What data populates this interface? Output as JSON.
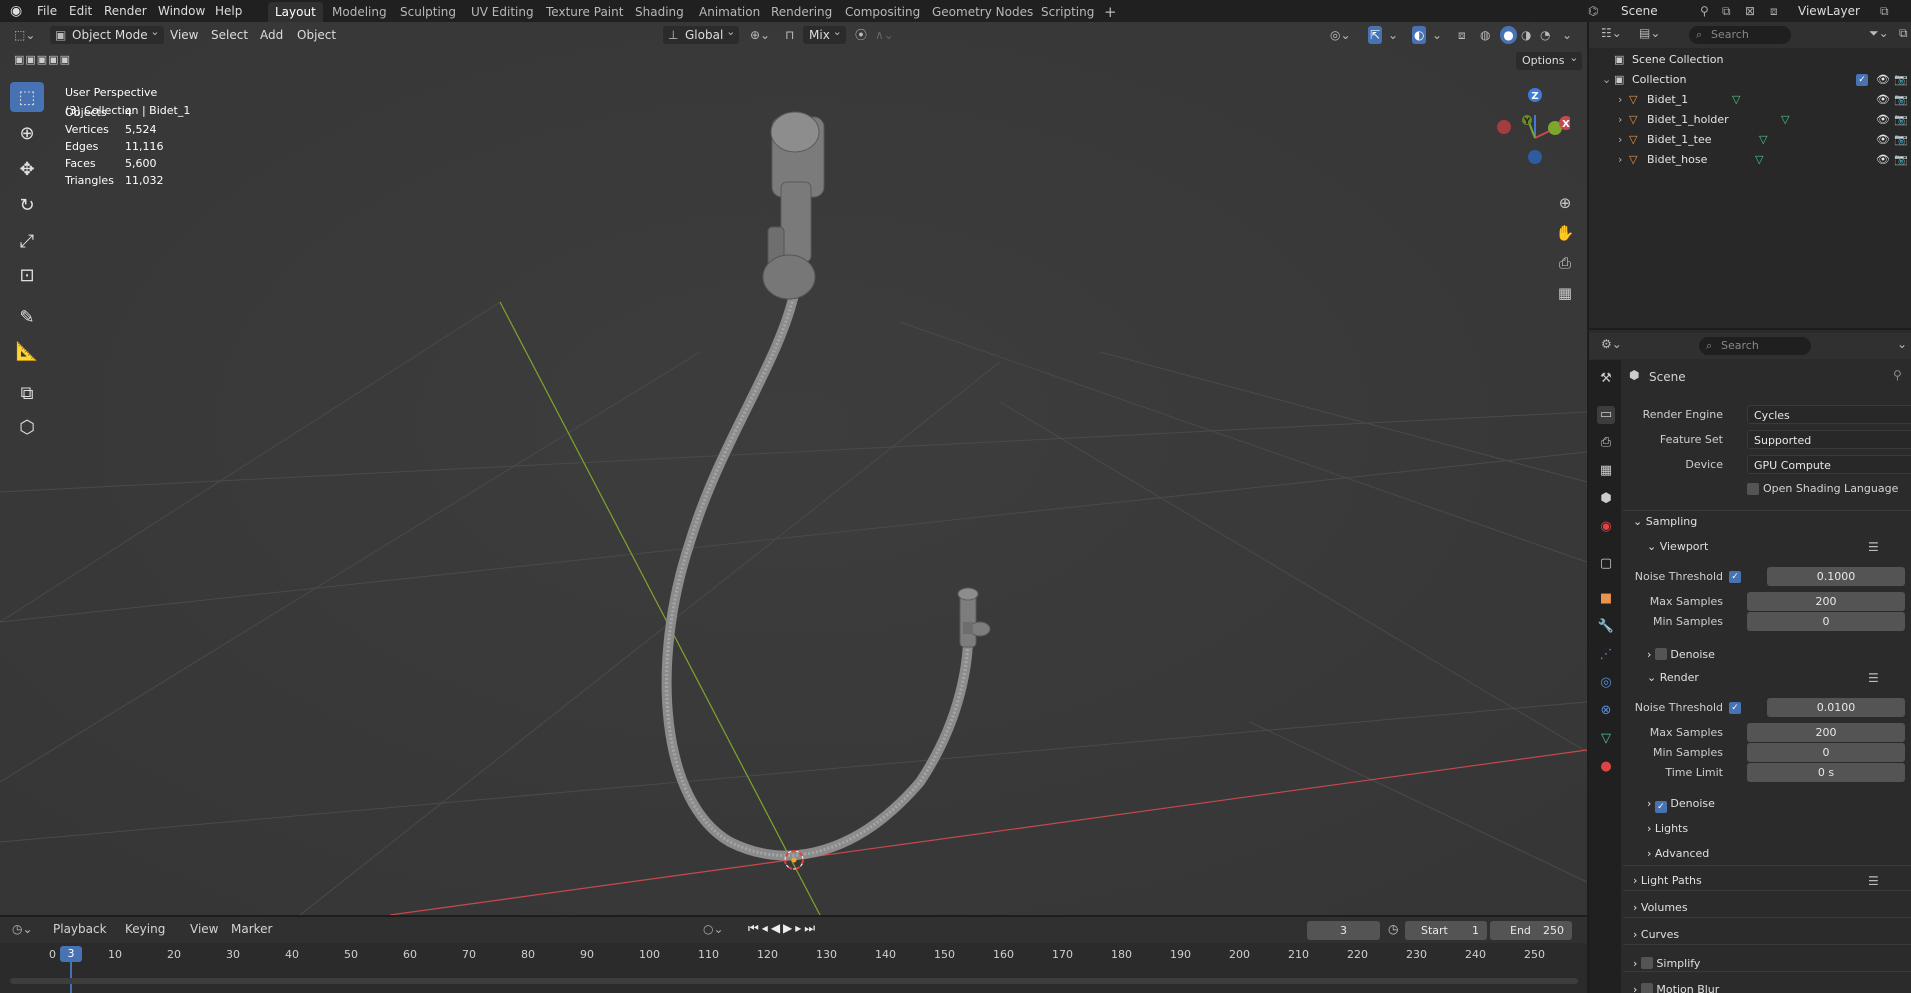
{
  "topbar": {
    "menus": [
      "File",
      "Edit",
      "Render",
      "Window",
      "Help"
    ],
    "workspaces": [
      "Layout",
      "Modeling",
      "Sculpting",
      "UV Editing",
      "Texture Paint",
      "Shading",
      "Animation",
      "Rendering",
      "Compositing",
      "Geometry Nodes",
      "Scripting"
    ],
    "active_workspace": "Layout",
    "add_tab": "+",
    "scene": "Scene",
    "view_layer": "ViewLayer"
  },
  "viewport_header": {
    "mode": "Object Mode",
    "menus": [
      "View",
      "Select",
      "Add",
      "Object"
    ],
    "transform_orientation": "Global",
    "snap": "Mix",
    "options": "Options"
  },
  "overlay_text": {
    "perspective": "User Perspective",
    "collection": "(3) Collection | Bidet_1"
  },
  "stats": [
    {
      "label": "Objects",
      "value": "4"
    },
    {
      "label": "Vertices",
      "value": "5,524"
    },
    {
      "label": "Edges",
      "value": "11,116"
    },
    {
      "label": "Faces",
      "value": "5,600"
    },
    {
      "label": "Triangles",
      "value": "11,032"
    }
  ],
  "gizmo": {
    "z": "Z",
    "y": "Y",
    "x": "X"
  },
  "outliner": {
    "search_placeholder": "Search",
    "scene_collection": "Scene Collection",
    "collection": "Collection",
    "objects": [
      "Bidet_1",
      "Bidet_1_holder",
      "Bidet_1_tee",
      "Bidet_hose"
    ]
  },
  "properties": {
    "search_placeholder": "Search",
    "context": "Scene",
    "render_engine_label": "Render Engine",
    "render_engine": "Cycles",
    "feature_set_label": "Feature Set",
    "feature_set": "Supported",
    "device_label": "Device",
    "device": "GPU Compute",
    "osl_label": "Open Shading Language",
    "sampling": "Sampling",
    "viewport": "Viewport",
    "noise_threshold_label": "Noise Threshold",
    "vp_noise_threshold": "0.1000",
    "max_samples_label": "Max Samples",
    "vp_max_samples": "200",
    "min_samples_label": "Min Samples",
    "vp_min_samples": "0",
    "denoise_label": "Denoise",
    "render": "Render",
    "r_noise_threshold": "0.0100",
    "r_max_samples": "200",
    "r_min_samples": "0",
    "time_limit_label": "Time Limit",
    "time_limit": "0 s",
    "lights": "Lights",
    "advanced": "Advanced",
    "light_paths": "Light Paths",
    "volumes": "Volumes",
    "curves": "Curves",
    "simplify": "Simplify",
    "motion_blur": "Motion Blur"
  },
  "timeline": {
    "menus": [
      "Playback",
      "Keying",
      "View",
      "Marker"
    ],
    "current_frame": "3",
    "start_label": "Start",
    "start": "1",
    "end_label": "End",
    "end": "250",
    "ticks": [
      "0",
      "10",
      "20",
      "30",
      "40",
      "50",
      "60",
      "70",
      "80",
      "90",
      "100",
      "110",
      "120",
      "130",
      "140",
      "150",
      "160",
      "170",
      "180",
      "190",
      "200",
      "210",
      "220",
      "230",
      "240",
      "250"
    ]
  },
  "colors": {
    "accent": "#4772b3",
    "x_axis": "#c8494d",
    "y_axis": "#7fa52c",
    "z_axis": "#3f7ad6"
  }
}
